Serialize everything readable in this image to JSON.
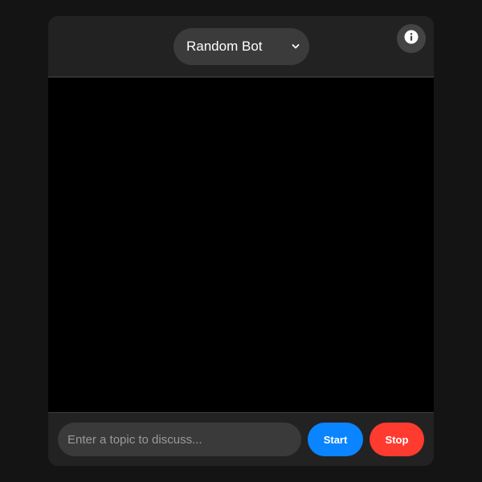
{
  "header": {
    "bot_select": {
      "selected": "Random Bot"
    },
    "info_icon": "info-icon"
  },
  "footer": {
    "topic_input": {
      "value": "",
      "placeholder": "Enter a topic to discuss..."
    },
    "start_label": "Start",
    "stop_label": "Stop"
  },
  "colors": {
    "page_background": "#141414",
    "panel_background": "#222222",
    "chat_background": "#000000",
    "start_button": "#0a84ff",
    "stop_button": "#ff3b30"
  }
}
